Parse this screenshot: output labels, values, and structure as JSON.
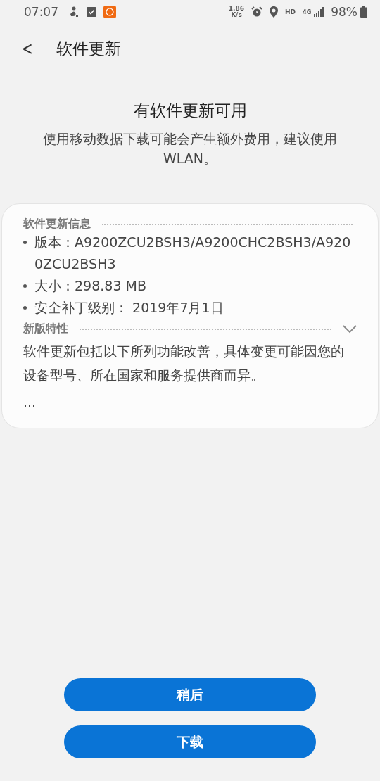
{
  "status_bar": {
    "time": "07:07",
    "speed_value": "1.86",
    "speed_unit": "K/s",
    "hd": "HD",
    "network": "4G",
    "battery": "98%"
  },
  "header": {
    "back": "<",
    "title": "软件更新"
  },
  "notice": {
    "title": "有软件更新可用",
    "message": "使用移动数据下载可能会产生额外费用，建议使用 WLAN。"
  },
  "card": {
    "sections": [
      {
        "kind": "list",
        "heading": "软件更新信息",
        "items": [
          "版本：A9200ZCU2BSH3/A9200CHC2BSH3/A9200ZCU2BSH3",
          "大小：298.83 MB",
          "安全补丁级别： 2019年7月1日"
        ]
      },
      {
        "kind": "text",
        "heading": "新版特性",
        "expanded": false,
        "paragraphs": [
          "软件更新包括以下所列功能改善，具体变更可能因您的设备型号、所在国家和服务提供商而异。",
          "..."
        ]
      }
    ]
  },
  "buttons": [
    "稍后",
    "下载"
  ]
}
